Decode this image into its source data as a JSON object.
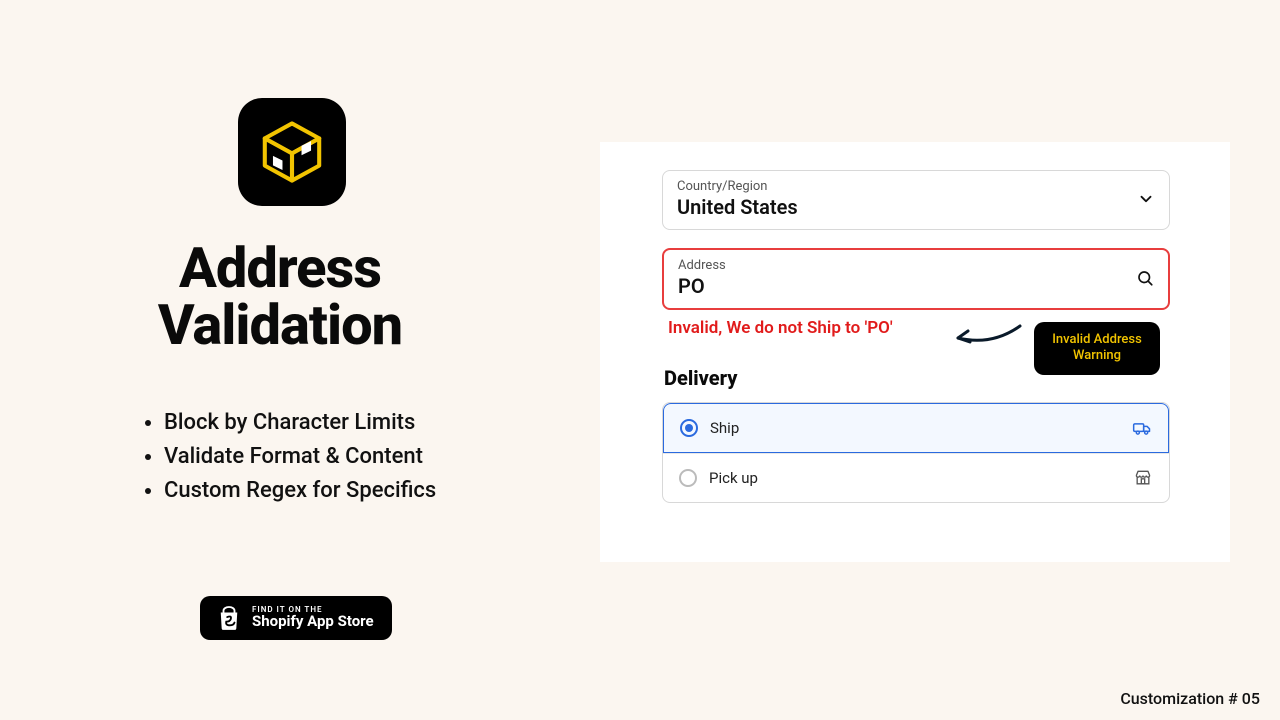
{
  "left": {
    "headline_line1": "Address",
    "headline_line2": "Validation",
    "bullets": [
      "Block by Character Limits",
      "Validate Format & Content",
      "Custom Regex for Specifics"
    ],
    "store_badge_small": "FIND IT ON THE",
    "store_badge_big": "Shopify App Store"
  },
  "panel": {
    "country_label": "Country/Region",
    "country_value": "United States",
    "address_label": "Address",
    "address_value": "PO",
    "error_message": "Invalid, We do not Ship to 'PO'",
    "tooltip_line1": "Invalid Address",
    "tooltip_line2": "Warning",
    "delivery_title": "Delivery",
    "ship_label": "Ship",
    "pickup_label": "Pick up"
  },
  "footer": "Customization # 05",
  "colors": {
    "bg": "#fbf6f0",
    "error": "#e11b1b",
    "accent_blue": "#2a6adf",
    "brand_yellow": "#f2c400"
  }
}
